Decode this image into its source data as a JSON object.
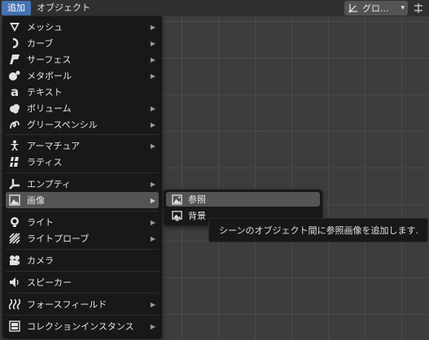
{
  "header": {
    "menus": [
      "追加",
      "オブジェクト"
    ],
    "orientation_label": "グロ..."
  },
  "menu": {
    "items": [
      {
        "label": "メッシュ",
        "icon": "mesh-icon"
      },
      {
        "label": "カーブ",
        "icon": "curve-icon"
      },
      {
        "label": "サーフェス",
        "icon": "surface-icon"
      },
      {
        "label": "メタボール",
        "icon": "metaball-icon"
      },
      {
        "label": "テキスト",
        "icon": "text-icon"
      },
      {
        "label": "ボリューム",
        "icon": "volume-icon"
      },
      {
        "label": "グリースペンシル",
        "icon": "grease-pencil-icon"
      },
      {
        "label": "アーマチュア",
        "icon": "armature-icon"
      },
      {
        "label": "ラティス",
        "icon": "lattice-icon"
      },
      {
        "label": "エンプティ",
        "icon": "empty-icon"
      },
      {
        "label": "画像",
        "icon": "image-icon"
      },
      {
        "label": "ライト",
        "icon": "light-icon"
      },
      {
        "label": "ライトプローブ",
        "icon": "light-probe-icon"
      },
      {
        "label": "カメラ",
        "icon": "camera-icon"
      },
      {
        "label": "スピーカー",
        "icon": "speaker-icon"
      },
      {
        "label": "フォースフィールド",
        "icon": "force-field-icon"
      },
      {
        "label": "コレクションインスタンス",
        "icon": "collection-instance-icon"
      }
    ]
  },
  "submenu": {
    "items": [
      {
        "label": "参照",
        "icon": "image-reference-icon"
      },
      {
        "label": "背景",
        "icon": "image-background-icon"
      }
    ]
  },
  "tooltip": {
    "text": "シーンのオブジェクト間に参照画像を追加します."
  },
  "colors": {
    "accent": "#4772b3",
    "menu_bg": "#181818",
    "hover_bg": "#545454",
    "viewport_bg": "#3d3d3d"
  }
}
